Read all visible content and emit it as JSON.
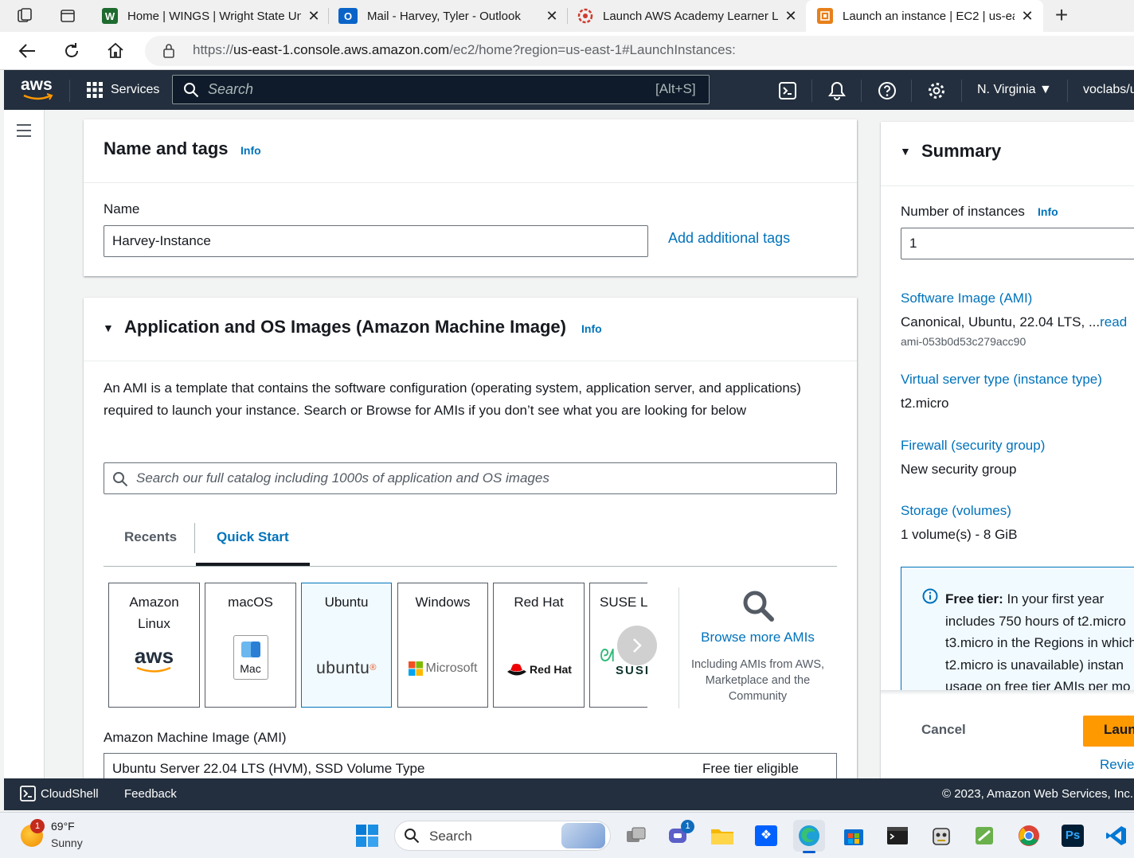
{
  "browser": {
    "tabs": [
      {
        "title": "Home | WINGS | Wright State Un",
        "icon": "wings-w-icon"
      },
      {
        "title": "Mail - Harvey, Tyler - Outlook",
        "icon": "outlook-icon"
      },
      {
        "title": "Launch AWS Academy Learner La",
        "icon": "aws-academy-icon"
      },
      {
        "title": "Launch an instance | EC2 | us-eas",
        "icon": "ec2-icon",
        "active": true
      }
    ],
    "url_prefix": "https://",
    "url_host": "us-east-1.console.aws.amazon.com",
    "url_path": "/ec2/home?region=us-east-1#LaunchInstances:"
  },
  "aws_nav": {
    "logo": "aws",
    "services": "Services",
    "search_placeholder": "Search",
    "search_shortcut": "[Alt+S]",
    "region": "N. Virginia",
    "account": "voclabs/u"
  },
  "name_tags": {
    "title": "Name and tags",
    "info": "Info",
    "name_label": "Name",
    "name_value": "Harvey-Instance",
    "add_tags": "Add additional tags"
  },
  "ami_section": {
    "title": "Application and OS Images (Amazon Machine Image)",
    "info": "Info",
    "description": "An AMI is a template that contains the software configuration (operating system, application server, and applications) required to launch your instance. Search or Browse for AMIs if you don’t see what you are looking for below",
    "search_placeholder": "Search our full catalog including 1000s of application and OS images",
    "tabs": [
      "Recents",
      "Quick Start"
    ],
    "active_tab": "Quick Start",
    "cards": [
      {
        "name": "Amazon Linux",
        "logo": "aws"
      },
      {
        "name": "macOS",
        "logo": "Mac"
      },
      {
        "name": "Ubuntu",
        "logo": "ubuntu"
      },
      {
        "name": "Windows",
        "logo": "Microsoft"
      },
      {
        "name": "Red Hat",
        "logo": "Red Hat"
      },
      {
        "name": "SUSE Li",
        "logo": "SUSI"
      }
    ],
    "selected_card": "Ubuntu",
    "browse_more": "Browse more AMIs",
    "browse_sub": "Including AMIs from AWS, Marketplace and the Community",
    "ami_label": "Amazon Machine Image (AMI)",
    "ami_value": "Ubuntu Server 22.04 LTS (HVM), SSD Volume Type",
    "ami_badge": "Free tier eligible"
  },
  "summary": {
    "title": "Summary",
    "num_instances_label": "Number of instances",
    "info": "Info",
    "num_instances_value": "1",
    "software_image_label": "Software Image (AMI)",
    "software_image_value": "Canonical, Ubuntu, 22.04 LTS, ...",
    "read_more": "read",
    "ami_id": "ami-053b0d53c279acc90",
    "instance_type_label": "Virtual server type (instance type)",
    "instance_type_value": "t2.micro",
    "firewall_label": "Firewall (security group)",
    "firewall_value": "New security group",
    "storage_label": "Storage (volumes)",
    "storage_value": "1 volume(s) - 8 GiB",
    "free_tier_bold": "Free tier:",
    "free_tier_lines": [
      " In your first year",
      "includes 750 hours of t2.micro",
      "t3.micro in the Regions in which",
      "t2.micro is unavailable) instan",
      "usage on free tier AMIs per mo"
    ],
    "cancel": "Cancel",
    "launch": "Laun",
    "review": "Revie"
  },
  "footer": {
    "cloudshell": "CloudShell",
    "feedback": "Feedback",
    "copyright": "© 2023, Amazon Web Services, Inc."
  },
  "taskbar": {
    "weather_temp": "69°F",
    "weather_cond": "Sunny",
    "weather_badge": "1",
    "search": "Search",
    "teams_badge": "1"
  },
  "colors": {
    "aws_nav": "#232f3e",
    "link": "#0073bb",
    "launch": "#ff9900",
    "selected_card": "#f1faff"
  }
}
